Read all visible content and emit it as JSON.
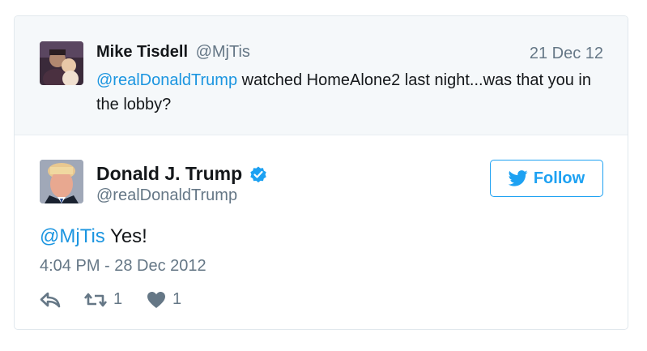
{
  "parent_tweet": {
    "name": "Mike Tisdell",
    "handle": "@MjTis",
    "date": "21 Dec 12",
    "mention": "@realDonaldTrump",
    "text": " watched HomeAlone2 last night...was that you in the lobby?"
  },
  "tweet": {
    "name": "Donald J. Trump",
    "handle": "@realDonaldTrump",
    "verified_icon": "verified-badge-icon",
    "follow_label": "Follow",
    "mention": "@MjTis",
    "text": " Yes!",
    "timestamp": "4:04 PM - 28 Dec 2012",
    "actions": {
      "reply_icon": "reply-icon",
      "retweet_icon": "retweet-icon",
      "retweet_count": "1",
      "like_icon": "heart-icon",
      "like_count": "1"
    }
  },
  "colors": {
    "link_blue": "#1b95e0",
    "brand_blue": "#1da1f2",
    "muted_gray": "#657786"
  }
}
